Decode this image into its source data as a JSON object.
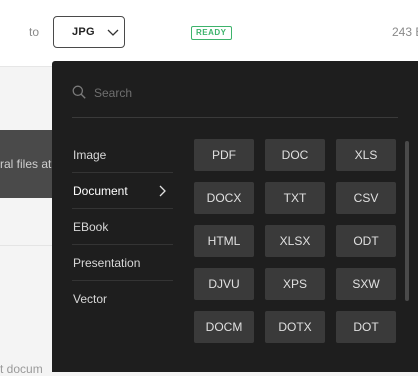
{
  "toolbar": {
    "to_label": "to",
    "selected_format": "JPG",
    "status_badge": "READY",
    "file_size": "243 B"
  },
  "background": {
    "drop_text": "ral files at",
    "bottom_text": "t docum"
  },
  "dropdown": {
    "search_placeholder": "Search",
    "categories": [
      {
        "label": "Image"
      },
      {
        "label": "Document"
      },
      {
        "label": "EBook"
      },
      {
        "label": "Presentation"
      },
      {
        "label": "Vector"
      }
    ],
    "active_category": "Document",
    "formats": [
      "PDF",
      "DOC",
      "XLS",
      "DOCX",
      "TXT",
      "CSV",
      "HTML",
      "XLSX",
      "ODT",
      "DJVU",
      "XPS",
      "SXW",
      "DOCM",
      "DOTX",
      "DOT"
    ]
  },
  "colors": {
    "dropdown_bg": "#1e1e1e",
    "format_button_bg": "#3a3a3a",
    "ready_green": "#3db36b"
  }
}
